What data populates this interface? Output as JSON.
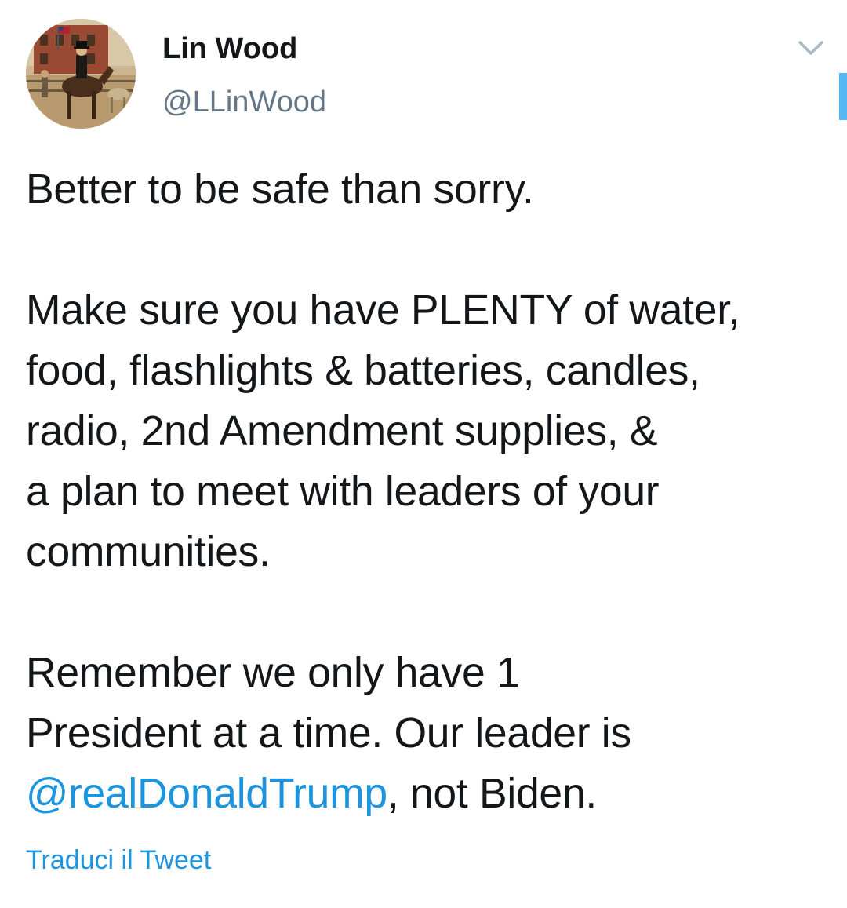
{
  "author": {
    "name": "Lin Wood",
    "handle": "@LLinWood",
    "avatar_icon": "avatar-horse-rider-painting"
  },
  "menu": {
    "icon": "chevron-down-icon"
  },
  "tweet": {
    "lines": [
      "Better to be safe than sorry.",
      "",
      "Make sure you have PLENTY of water,",
      "food, flashlights & batteries, candles,",
      "radio, 2nd Amendment supplies, &",
      "a plan to meet with leaders of your",
      "communities.",
      "",
      "Remember we only have 1",
      "President at a time. Our leader is"
    ],
    "mention": "@realDonaldTrump",
    "after_mention": ", not Biden."
  },
  "translate_label": "Traduci il Tweet",
  "colors": {
    "link": "#1b95e0",
    "text": "#14171a",
    "secondary": "#657786",
    "accent": "#1da1f2"
  }
}
